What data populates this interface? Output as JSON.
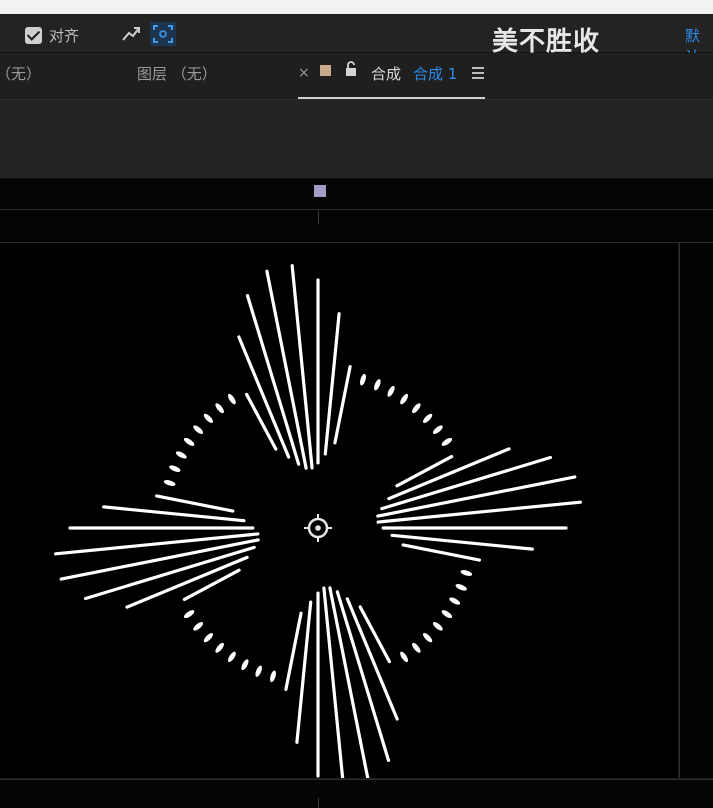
{
  "toolbar": {
    "snap_label": "对齐",
    "brand_text": "美不胜收",
    "preset_label": "默认"
  },
  "tabs": {
    "footage_label": "（无）",
    "layer_label": "图层 （无）",
    "comp_close": "×",
    "comp_title": "合成",
    "comp_name": "合成 1"
  },
  "colors": {
    "comp_swatch": "#c8a98b",
    "accent_blue": "#2d8ceb",
    "time_marker": "#a49bc7"
  },
  "icons": [
    "checkbox-checked-icon",
    "arrow-snap-icon",
    "target-frame-icon",
    "lock-icon",
    "hamburger-menu-icon",
    "anchor-crosshair-icon"
  ]
}
